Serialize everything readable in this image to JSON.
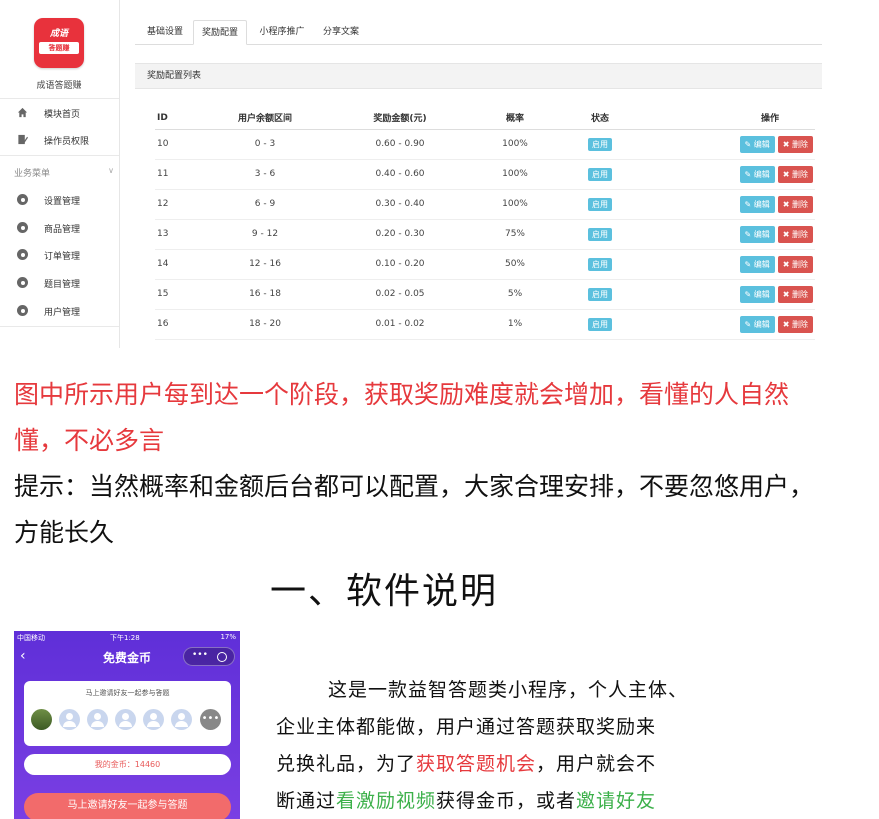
{
  "sidebar": {
    "logo_line1": "成语",
    "logo_line2": "答题赚",
    "app_name": "成语答题赚",
    "top_items": [
      {
        "label": "模块首页",
        "icon": "home-icon"
      },
      {
        "label": "操作员权限",
        "icon": "edit-icon"
      }
    ],
    "group_label": "业务菜单",
    "group_items": [
      {
        "label": "设置管理",
        "icon": "gear-icon"
      },
      {
        "label": "商品管理",
        "icon": "gear-icon"
      },
      {
        "label": "订单管理",
        "icon": "gear-icon"
      },
      {
        "label": "题目管理",
        "icon": "gear-icon"
      },
      {
        "label": "用户管理",
        "icon": "gear-icon"
      }
    ]
  },
  "tabs": [
    {
      "label": "基础设置",
      "active": false
    },
    {
      "label": "奖励配置",
      "active": true
    },
    {
      "label": "小程序推广",
      "active": false
    },
    {
      "label": "分享文案",
      "active": false
    }
  ],
  "panel": {
    "title": "奖励配置列表",
    "headers": [
      "ID",
      "用户余额区间",
      "奖励金额(元)",
      "概率",
      "状态",
      "操作"
    ],
    "edit_label": "编辑",
    "delete_label": "删除",
    "rows": [
      {
        "id": "10",
        "range": "0 - 3",
        "reward": "0.60 - 0.90",
        "prob": "100%",
        "status": "启用"
      },
      {
        "id": "11",
        "range": "3 - 6",
        "reward": "0.40 - 0.60",
        "prob": "100%",
        "status": "启用"
      },
      {
        "id": "12",
        "range": "6 - 9",
        "reward": "0.30 - 0.40",
        "prob": "100%",
        "status": "启用"
      },
      {
        "id": "13",
        "range": "9 - 12",
        "reward": "0.20 - 0.30",
        "prob": "75%",
        "status": "启用"
      },
      {
        "id": "14",
        "range": "12 - 16",
        "reward": "0.10 - 0.20",
        "prob": "50%",
        "status": "启用"
      },
      {
        "id": "15",
        "range": "16 - 18",
        "reward": "0.02 - 0.05",
        "prob": "5%",
        "status": "启用"
      },
      {
        "id": "16",
        "range": "18 - 20",
        "reward": "0.01 - 0.02",
        "prob": "1%",
        "status": "启用"
      }
    ]
  },
  "notes": {
    "red": "图中所示用户每到达一个阶段，获取奖励难度就会增加，看懂的人自然懂，不必多言",
    "black": "提示：当然概率和金额后台都可以配置，大家合理安排，不要忽悠用户，方能长久"
  },
  "section_title": "一、软件说明",
  "phone": {
    "carrier": "中国移动",
    "time": "下午1:28",
    "battery": "17%",
    "title": "免费金币",
    "invite_hint": "马上邀请好友一起参与答题",
    "coins_label": "我的金币：14460",
    "invite_button": "马上邀请好友一起参与答题"
  },
  "description": {
    "l1": "这是一款益智答题类小程序，个人主体、",
    "l2": "企业主体都能做，用户通过答题获取奖励来",
    "l3a": "兑换礼品，为了",
    "l3b": "获取答题机会",
    "l3c": "，用户就会不",
    "l4a": "断通过",
    "l4b": "看激励视频",
    "l4c": "获得金币，或者",
    "l4d": "邀请好友"
  },
  "colors": {
    "accent_red": "#e6393d",
    "accent_green": "#3cb04a",
    "phone_purple": "#6a35dc"
  }
}
